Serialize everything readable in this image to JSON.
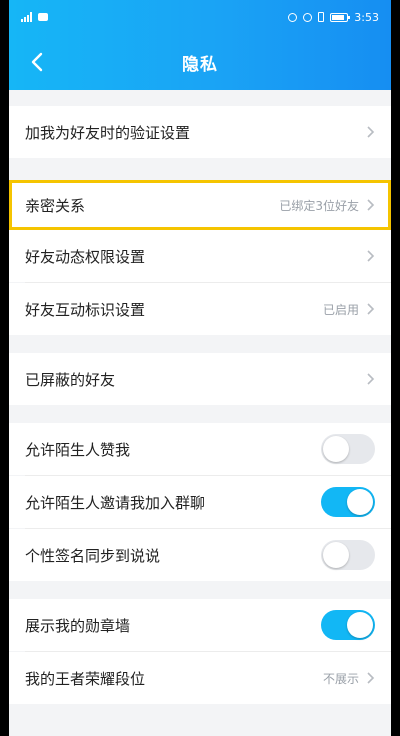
{
  "status": {
    "time": "3:53"
  },
  "nav": {
    "title": "隐私"
  },
  "rows": {
    "verify": {
      "label": "加我为好友时的验证设置"
    },
    "intimate": {
      "label": "亲密关系",
      "value": "已绑定3位好友"
    },
    "moments": {
      "label": "好友动态权限设置"
    },
    "interaction": {
      "label": "好友互动标识设置",
      "value": "已启用"
    },
    "blocked": {
      "label": "已屏蔽的好友"
    },
    "stranger_like": {
      "label": "允许陌生人赞我",
      "on": false
    },
    "stranger_group": {
      "label": "允许陌生人邀请我加入群聊",
      "on": true
    },
    "signature_sync": {
      "label": "个性签名同步到说说",
      "on": false
    },
    "badge_wall": {
      "label": "展示我的勋章墙",
      "on": true
    },
    "honor_rank": {
      "label": "我的王者荣耀段位",
      "value": "不展示"
    }
  },
  "colors": {
    "accent": "#12b7f5",
    "highlight": "#f5c400",
    "header_start": "#16b6f6",
    "header_end": "#168ef2"
  }
}
